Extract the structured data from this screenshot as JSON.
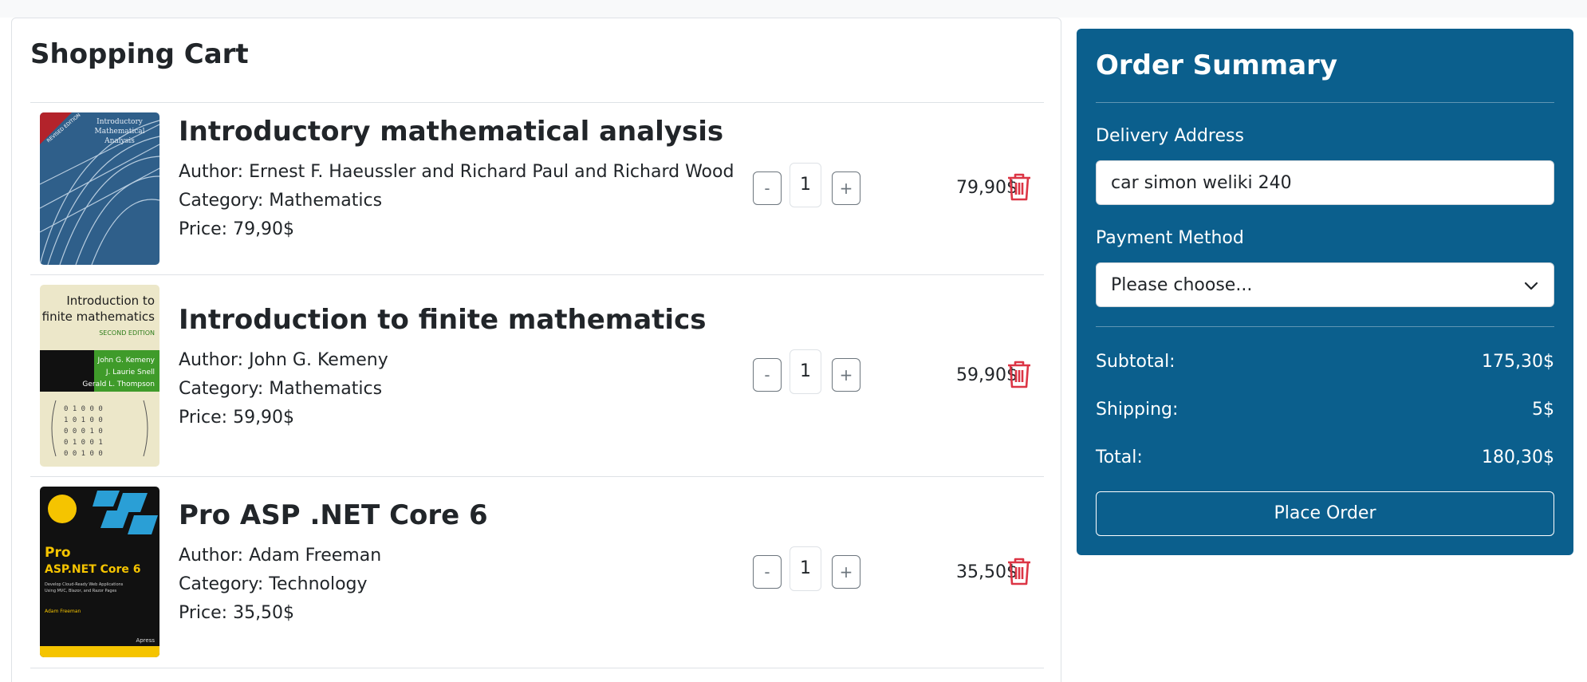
{
  "cart": {
    "title": "Shopping Cart",
    "items": [
      {
        "title": "Introductory mathematical analysis",
        "author": "Author: Ernest F. Haeussler and Richard Paul and Richard Wood",
        "category": "Category: Mathematics",
        "price": "Price: 79,90$",
        "qty": "1",
        "line_total": "79,90$",
        "cover": {
          "line1": "Introductory",
          "line2": "Mathematical",
          "line3": "Analysis",
          "badge": "REVISED EDITION"
        }
      },
      {
        "title": "Introduction to finite mathematics",
        "author": "Author: John G. Kemeny",
        "category": "Category: Mathematics",
        "price": "Price: 59,90$",
        "qty": "1",
        "line_total": "59,90$",
        "cover": {
          "line1": "Introduction to",
          "line2": "finite mathematics",
          "edition": "SECOND EDITION",
          "author1": "John G. Kemeny",
          "author2": "J. Laurie Snell",
          "author3": "Gerald L. Thompson"
        }
      },
      {
        "title": "Pro ASP .NET Core 6",
        "author": "Author: Adam Freeman",
        "category": "Category: Technology",
        "price": "Price: 35,50$",
        "qty": "1",
        "line_total": "35,50$",
        "cover": {
          "line1": "Pro",
          "line2": "ASP.NET Core 6",
          "author": "Adam Freeman",
          "publisher": "Apress"
        }
      }
    ],
    "minus_label": "-",
    "plus_label": "+"
  },
  "summary": {
    "title": "Order Summary",
    "delivery_label": "Delivery Address",
    "delivery_value": "car simon weliki 240",
    "payment_label": "Payment Method",
    "payment_selected": "Please choose...",
    "subtotal_label": "Subtotal:",
    "subtotal_value": "175,30$",
    "shipping_label": "Shipping:",
    "shipping_value": "5$",
    "total_label": "Total:",
    "total_value": "180,30$",
    "place_order_label": "Place Order"
  },
  "colors": {
    "summary_bg": "#0b5f8d",
    "trash": "#dc3545",
    "divider": "#dee2e6"
  },
  "icons": {
    "trash": "trash-icon",
    "select_arrow": "chevron-down-icon"
  }
}
